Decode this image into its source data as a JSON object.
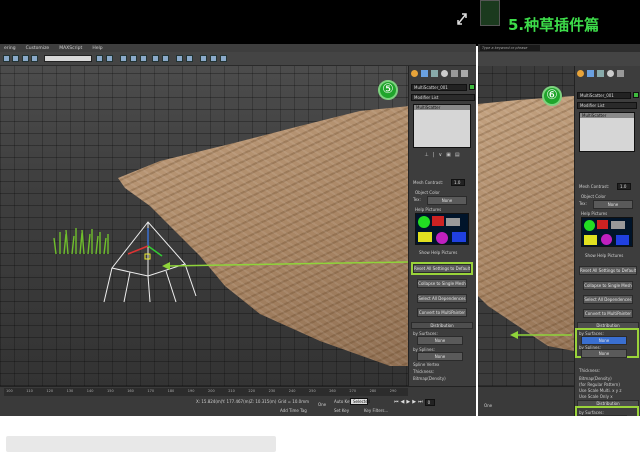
{
  "banner": {
    "title": "5.种草插件篇"
  },
  "menu": [
    "ering",
    "Customize",
    "MAXScript",
    "Help"
  ],
  "search": {
    "placeholder": "Type a keyword or phrase"
  },
  "steps": {
    "left": "⑤",
    "right": "⑥"
  },
  "panel": {
    "object_name": "MultiScatter_001",
    "modifier_list": "Modifier List",
    "stack_item": "MultiScatter",
    "mesh_contrast_label": "Mesh Contrast:",
    "mesh_contrast_value": "1.0",
    "object_color_label": "Object Color",
    "tex_label": "Tex:",
    "tex_value": "None",
    "help_pictures_label": "Help Pictures",
    "show_help_pictures": "Show Help Pictures",
    "reset_btn": "Reset All Settings to Default",
    "collapse_btn": "Collapse to Single Mesh",
    "select_deps_btn": "Select All Dependences",
    "convert_btn": "Convert to MultiPainter",
    "distribution_label": "Distribution",
    "surfaces_label": "by Surfaces:",
    "surfaces_value": "None",
    "splines_label": "by Splines:",
    "splines_value": "None",
    "spline_vertex_label": "Spline Vertex",
    "thickness_label": "Thickness:",
    "bitmap_label": "Bitmap(Density)",
    "regular_pattern": "(for Regular Pattern)",
    "scale_label": "Use Scale Multi. x y z",
    "scale_only": "Use Scale Only x"
  },
  "right_panel": {
    "object_name": "MultiScatter_001",
    "modifier_list": "Modifier List",
    "stack_item": "MultiScatter",
    "mesh_contrast_label": "Mesh Contrast:",
    "mesh_contrast_value": "1.0",
    "object_color_label": "Object Color",
    "tex_label": "Tex:",
    "tex_value": "None",
    "help_pictures_label": "Help Pictures",
    "show_help_pictures": "Show Help Pictures",
    "reset_btn": "Reset All Settings to Default",
    "collapse_btn": "Collapse to Single Mesh",
    "select_deps_btn": "Select All Dependences",
    "convert_btn": "Convert to MultiPainter",
    "distribution_label": "Distribution",
    "surfaces_label": "by Surfaces:",
    "surfaces_value": "None",
    "splines_label": "by Splines:",
    "splines_value": "None",
    "thickness_label": "Thickness:",
    "bitmap_label": "Bitmap(Density)",
    "regular_pattern": "(for Regular Pattern)",
    "scale_label": "Use Scale Multi. x y z",
    "scale_only": "Use Scale Only x",
    "distribution2_label": "Distribution",
    "surfaces2_label": "by Surfaces:",
    "surfaces2_value": "None",
    "splines2_label": "by Splines:",
    "splines2_value": "None"
  },
  "status": {
    "x": "X: 15.824(m)",
    "y": "Y: 177.467(m)",
    "z": "Z: 10.315(m)",
    "grid": "Grid = 10.0mm",
    "auto_key": "Auto Key",
    "selected": "Selected",
    "set_key": "Set Key",
    "key_filters": "Key Filters...",
    "add_time_tag": "Add Time Tag",
    "one": "One",
    "frame": "0",
    "ticks": [
      "100",
      "110",
      "120",
      "130",
      "140",
      "150",
      "160",
      "170",
      "180",
      "190",
      "200",
      "210",
      "220",
      "230",
      "240",
      "250",
      "260",
      "270",
      "280",
      "290"
    ]
  },
  "colors": {
    "accent_green": "#9ad33a",
    "step_green": "#1fa52b",
    "selection_blue": "#3a6fd0"
  }
}
